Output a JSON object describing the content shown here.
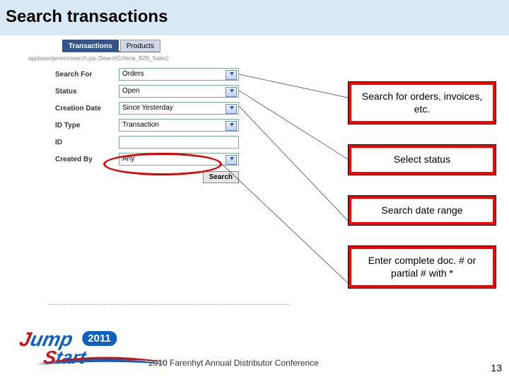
{
  "title": "Search transactions",
  "tabs": {
    "active": "Transactions",
    "other": "Products"
  },
  "breadcrumb": "appbase/genericsearch.jsp (SearchCriteria_B2B_Sales)",
  "form": {
    "search_for": {
      "label": "Search For",
      "value": "Orders"
    },
    "status": {
      "label": "Status",
      "value": "Open"
    },
    "creation_date": {
      "label": "Creation Date",
      "value": "Since Yesterday"
    },
    "id_type": {
      "label": "ID Type",
      "value": "Transaction"
    },
    "id": {
      "label": "ID",
      "value": ""
    },
    "created_by": {
      "label": "Created By",
      "value": "Any"
    },
    "search_button": "Search"
  },
  "callouts": {
    "c1": "Search for orders, invoices, etc.",
    "c2": "Select status",
    "c3": "Search date range",
    "c4": "Enter complete doc. # or partial # with *"
  },
  "logo": {
    "word1a": "J",
    "word1b": "ump",
    "year": "2011",
    "word2a": "S",
    "word2b": "tart"
  },
  "footer": "2010 Farenhyt Annual Distributor Conference",
  "page_number": "13"
}
